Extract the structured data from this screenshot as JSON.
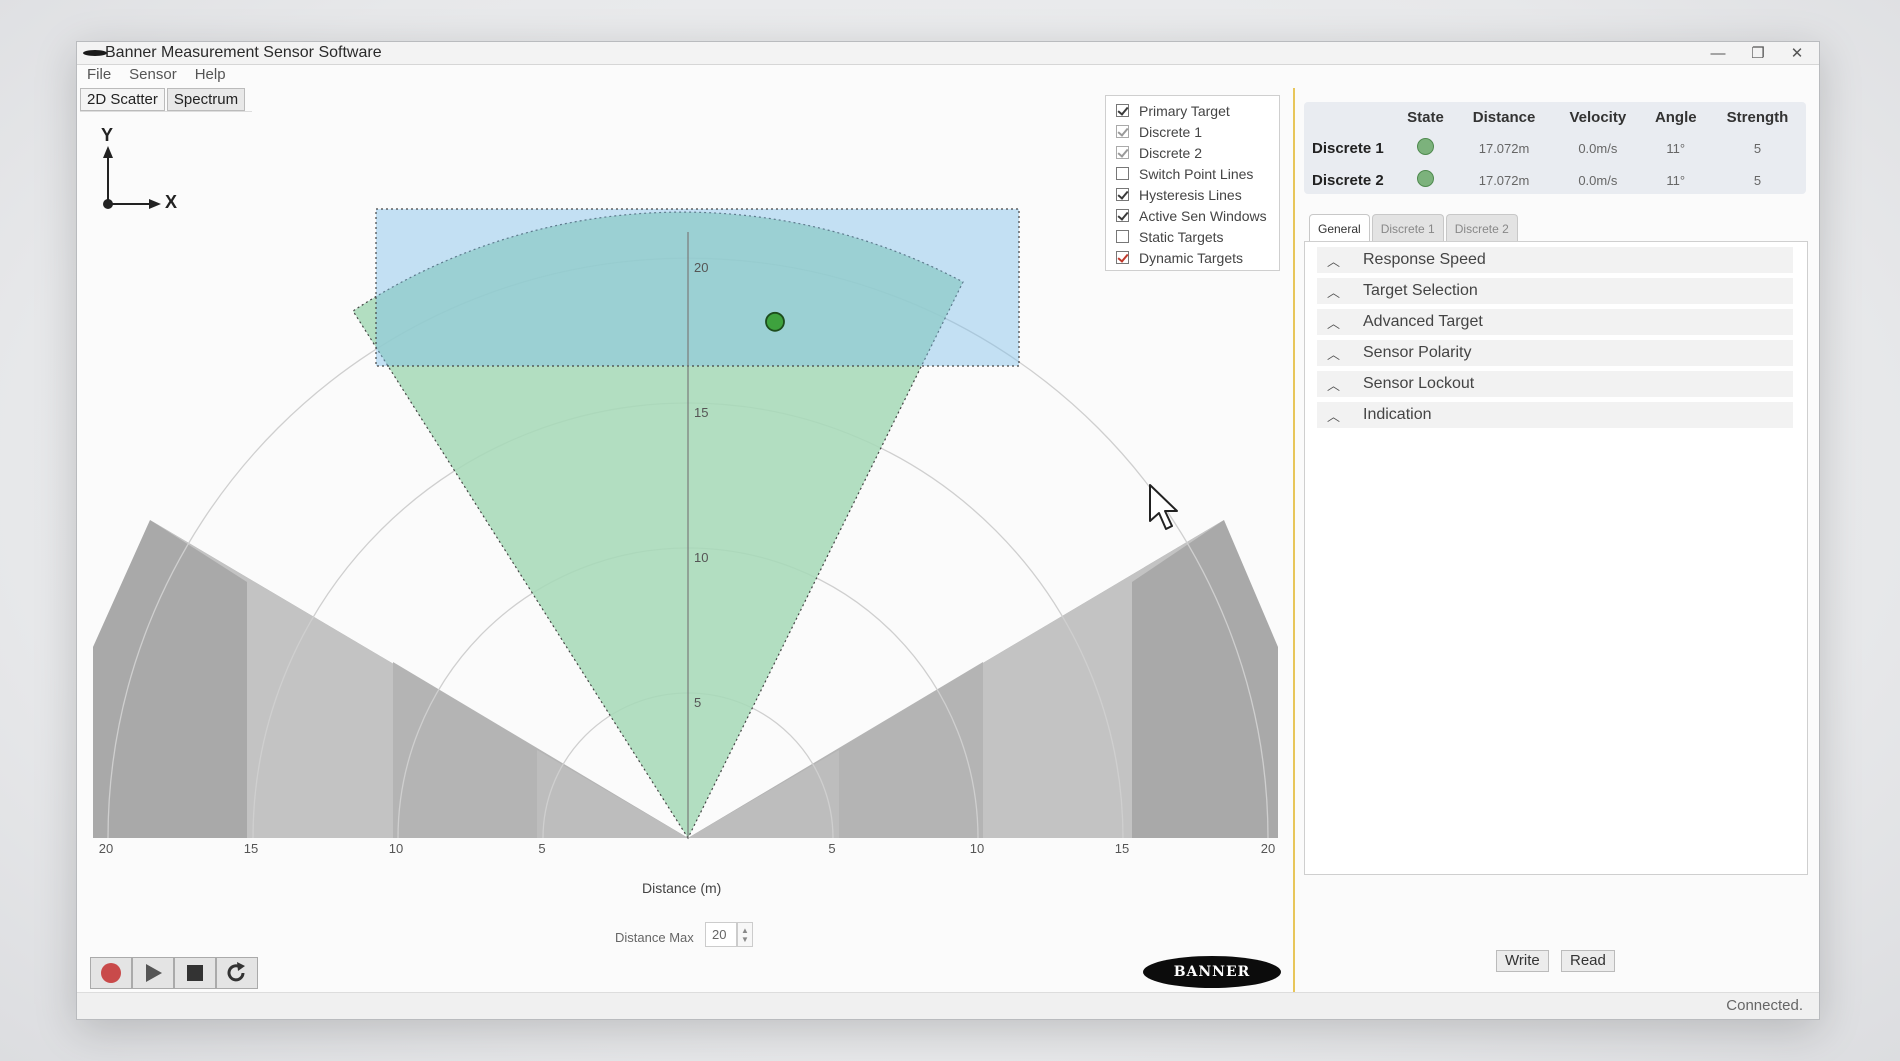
{
  "window": {
    "title": "Banner Measurement Sensor Software"
  },
  "menu": [
    "File",
    "Sensor",
    "Help"
  ],
  "view_tabs": [
    "2D Scatter",
    "Spectrum"
  ],
  "axes_indicator": {
    "y": "Y",
    "x": "X"
  },
  "legend": [
    {
      "label": "Primary Target",
      "checked": true
    },
    {
      "label": "Discrete 1",
      "checked": true
    },
    {
      "label": "Discrete 2",
      "checked": true
    },
    {
      "label": "Switch Point Lines",
      "checked": false
    },
    {
      "label": "Hysteresis Lines",
      "checked": true
    },
    {
      "label": "Active Sen Windows",
      "checked": true
    },
    {
      "label": "Static Targets",
      "checked": false
    },
    {
      "label": "Dynamic Targets",
      "checked": true
    }
  ],
  "chart_data": {
    "type": "scatter",
    "xlabel": "Distance (m)",
    "x_ticks": [
      "20",
      "15",
      "10",
      "5",
      "5",
      "10",
      "15",
      "20"
    ],
    "radial_ticks": [
      "5",
      "10",
      "15",
      "20"
    ],
    "targets": [
      {
        "x": 3,
        "y": 17.8
      }
    ]
  },
  "distance_max": {
    "label": "Distance Max",
    "value": "20"
  },
  "brand": "BANNER",
  "status_table": {
    "headers": [
      "",
      "State",
      "Distance",
      "Velocity",
      "Angle",
      "Strength"
    ],
    "rows": [
      {
        "name": "Discrete 1",
        "distance": "17.072m",
        "velocity": "0.0m/s",
        "angle": "11°",
        "strength": "5"
      },
      {
        "name": "Discrete 2",
        "distance": "17.072m",
        "velocity": "0.0m/s",
        "angle": "11°",
        "strength": "5"
      }
    ]
  },
  "config_tabs": [
    "General",
    "Discrete 1",
    "Discrete 2"
  ],
  "sections": [
    "Response Speed",
    "Target Selection",
    "Advanced Target",
    "Sensor Polarity",
    "Sensor Lockout",
    "Indication"
  ],
  "buttons": {
    "write": "Write",
    "read": "Read"
  },
  "status": "Connected.",
  "colors": {
    "zone_green": "#a7dab8",
    "zone_blue": "#bfe0f3",
    "target": "#3ea23e",
    "divider": "#e8c65a"
  }
}
